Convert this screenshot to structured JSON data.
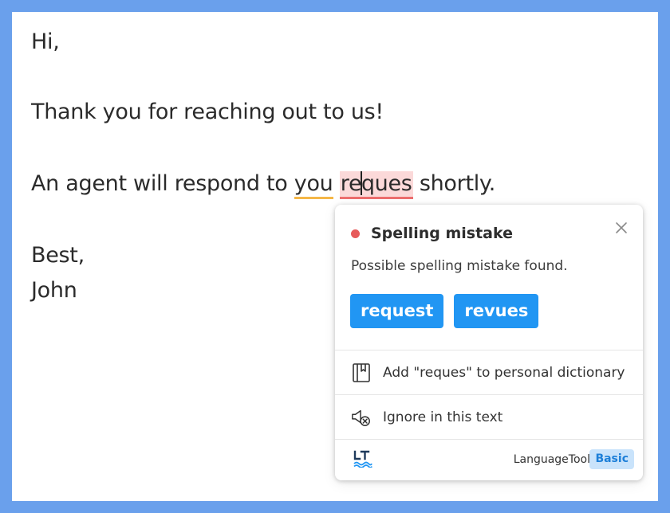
{
  "email": {
    "greeting": "Hi,",
    "line1": "Thank you for reaching out to us!",
    "line2_before": "An agent will respond to ",
    "line2_warn_word": "you",
    "line2_error_word_a": "re",
    "line2_error_word_b": "ques",
    "line2_after": " shortly.",
    "closing": "Best,",
    "signature": "John"
  },
  "popup": {
    "title": "Spelling mistake",
    "message": "Possible spelling mistake found.",
    "suggestions": [
      "request",
      "revues"
    ],
    "actions": [
      {
        "label": "Add \"reques\" to personal dictionary",
        "icon": "dictionary-icon"
      },
      {
        "label": "Ignore in this text",
        "icon": "ignore-icon"
      }
    ],
    "footer": {
      "brand": "LanguageTool",
      "plan": "Basic"
    }
  },
  "colors": {
    "background": "#6aa0ec",
    "error": "#e75a5a",
    "error_highlight": "#fbd9d9",
    "warning": "#f5b748",
    "accent": "#2196f3",
    "plan_badge_bg": "#c9e3fb"
  }
}
